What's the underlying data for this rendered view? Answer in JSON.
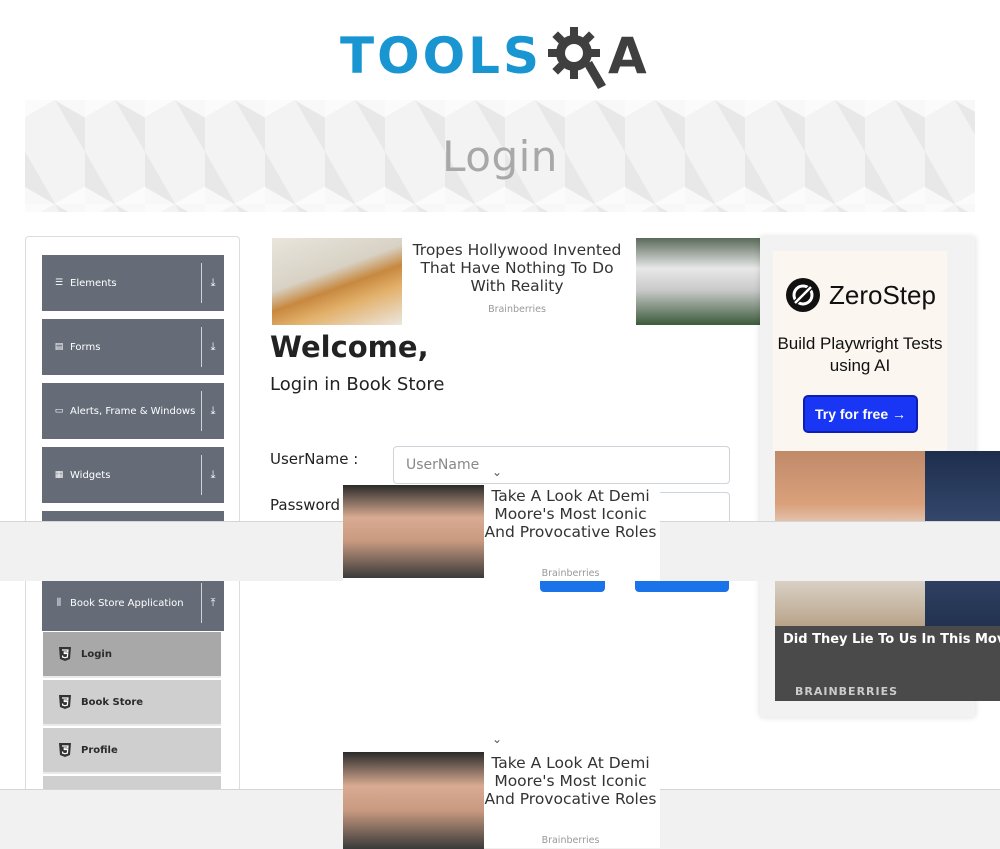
{
  "header": {
    "logo_part1": "TOOLS",
    "logo_part2": "A",
    "page_title": "Login"
  },
  "sidebar": {
    "groups": [
      {
        "label": "Elements",
        "icon": "list-icon"
      },
      {
        "label": "Forms",
        "icon": "form-icon"
      },
      {
        "label": "Alerts, Frame & Windows",
        "icon": "window-icon"
      },
      {
        "label": "Widgets",
        "icon": "grid-icon"
      },
      {
        "label": "Book Store Application",
        "icon": "books-icon"
      }
    ],
    "subitems": [
      {
        "label": "Login",
        "active": true
      },
      {
        "label": "Book Store",
        "active": false
      },
      {
        "label": "Profile",
        "active": false
      }
    ]
  },
  "main": {
    "welcome": "Welcome,",
    "subheading": "Login in Book Store",
    "username_label": "UserName :",
    "username_placeholder": "UserName",
    "password_label": "Password"
  },
  "ads": {
    "top": {
      "title": "Tropes Hollywood Invented That Have Nothing To Do With Reality",
      "source": "Brainberries"
    },
    "popup1": {
      "title": "Take A Look At Demi Moore's Most Iconic And Provocative Roles",
      "source": "Brainberries"
    },
    "popup2": {
      "title": "Take A Look At Demi Moore's Most Iconic And Provocative Roles",
      "source": "Brainberries"
    },
    "zerostep": {
      "name": "ZeroStep",
      "tagline": "Build Playwright Tests using AI",
      "button": "Try for free →"
    },
    "movie": {
      "caption": "Did They Lie To Us In This Movie",
      "source": "BRAINBERRIES"
    }
  },
  "colors": {
    "brand_blue": "#1996d1",
    "sidebar_group": "#666c77",
    "primary_button": "#1a73e8"
  }
}
